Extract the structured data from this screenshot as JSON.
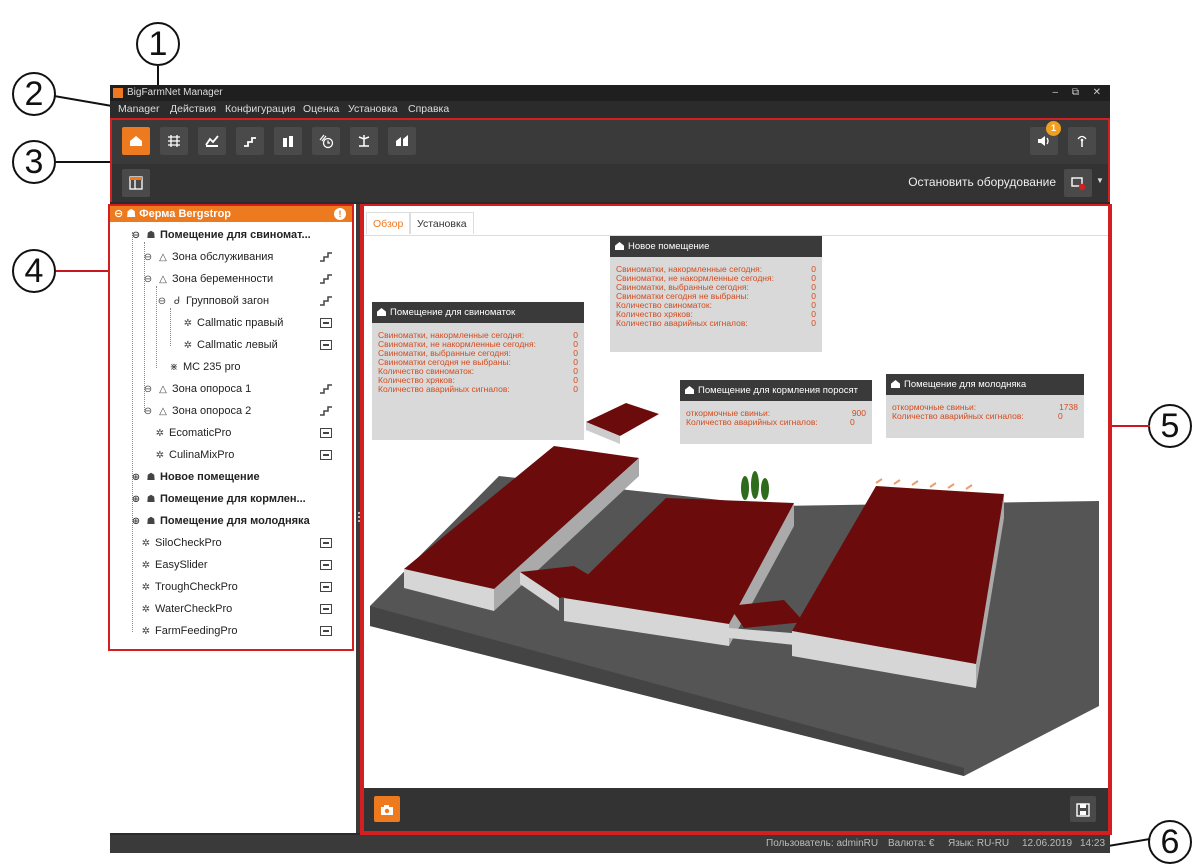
{
  "callouts": [
    "1",
    "2",
    "3",
    "4",
    "5",
    "6"
  ],
  "window": {
    "title": "BigFarmNet Manager",
    "controls": [
      "–",
      "⧉",
      "✕"
    ]
  },
  "menu": [
    "Manager",
    "Действия",
    "Конфигурация",
    "Оценка",
    "Установка",
    "Справка"
  ],
  "toolbar": {
    "stop_label": "Остановить оборудование",
    "notification_count": "1"
  },
  "tree": {
    "root": "Ферма Bergstrop",
    "root_alert": "!",
    "nodes": [
      {
        "label": "Помещение для свиномат...",
        "bold": true
      },
      {
        "label": "Зона обслуживания"
      },
      {
        "label": "Зона беременности"
      },
      {
        "label": "Групповой загон"
      },
      {
        "label": "Callmatic правый"
      },
      {
        "label": "Callmatic левый"
      },
      {
        "label": "MC 235 pro"
      },
      {
        "label": "Зона опороса 1"
      },
      {
        "label": "Зона опороса 2"
      },
      {
        "label": "EcomaticPro"
      },
      {
        "label": "CulinaMixPro"
      },
      {
        "label": "Новое помещение",
        "bold": true
      },
      {
        "label": "Помещение для кормлен...",
        "bold": true
      },
      {
        "label": "Помещение для молодняка",
        "bold": true
      },
      {
        "label": "SiloCheckPro"
      },
      {
        "label": "EasySlider"
      },
      {
        "label": "TroughCheckPro"
      },
      {
        "label": "WaterCheckPro"
      },
      {
        "label": "FarmFeedingPro"
      }
    ]
  },
  "tabs": [
    "Обзор",
    "Установка"
  ],
  "panels": {
    "sow": {
      "title": "Помещение для свиноматок",
      "rows": [
        {
          "label": "Свиноматки, накормленные сегодня:",
          "value": "0"
        },
        {
          "label": "Свиноматки, не накормленные сегодня:",
          "value": "0"
        },
        {
          "label": "Свиноматки, выбранные сегодня:",
          "value": "0"
        },
        {
          "label": "Свиноматки сегодня не выбраны:",
          "value": "0"
        },
        {
          "label": "Количество свиноматок:",
          "value": "0"
        },
        {
          "label": "Количество хряков:",
          "value": "0"
        },
        {
          "label": "Количество аварийных сигналов:",
          "value": "0"
        }
      ]
    },
    "new": {
      "title": "Новое помещение",
      "rows": [
        {
          "label": "Свиноматки, накормленные сегодня:",
          "value": "0"
        },
        {
          "label": "Свиноматки, не накормленные сегодня:",
          "value": "0"
        },
        {
          "label": "Свиноматки, выбранные сегодня:",
          "value": "0"
        },
        {
          "label": "Свиноматки сегодня не выбраны:",
          "value": "0"
        },
        {
          "label": "Количество свиноматок:",
          "value": "0"
        },
        {
          "label": "Количество хряков:",
          "value": "0"
        },
        {
          "label": "Количество аварийных сигналов:",
          "value": "0"
        }
      ]
    },
    "feeding": {
      "title": "Помещение для кормления поросят",
      "rows": [
        {
          "label": "откормочные свиньи:",
          "value": "900"
        },
        {
          "label": "Количество аварийных сигналов:",
          "value": "0"
        }
      ]
    },
    "young": {
      "title": "Помещение для молодняка",
      "rows": [
        {
          "label": "откормочные свиньи:",
          "value": "1738"
        },
        {
          "label": "Количество аварийных сигналов:",
          "value": "0"
        }
      ]
    }
  },
  "status": {
    "user": "Пользователь: adminRU",
    "currency": "Валюта: €",
    "language": "Язык: RU-RU",
    "date": "12.06.2019",
    "time": "14:23"
  },
  "colors": {
    "accent": "#ee7a1f",
    "highlight_border": "#d21f1f",
    "dark": "#2b2b2b",
    "roof": "#6b0b0b"
  },
  "icons": {
    "toolbar": [
      "barn-icon",
      "grid-icon",
      "feeding-icon",
      "stairs-icon",
      "silo-icon",
      "clock-icon",
      "scale-icon",
      "climate-icon"
    ],
    "right": [
      "speaker-icon",
      "antenna-icon"
    ],
    "stop": "stop-equipment-icon",
    "layout": "layout-icon",
    "camera": "camera-icon",
    "save": "save-icon"
  }
}
